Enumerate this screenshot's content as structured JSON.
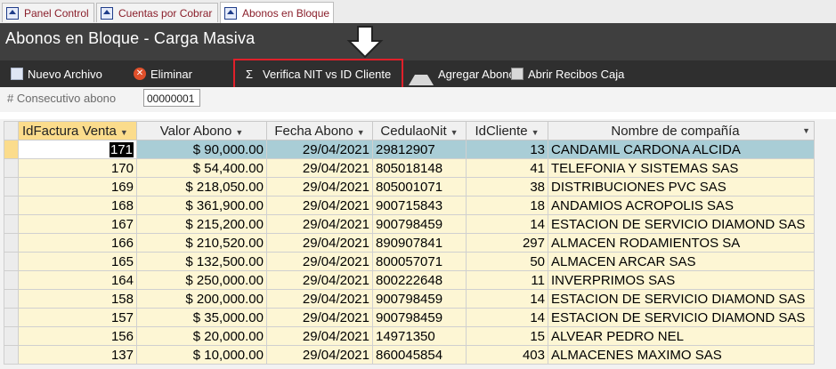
{
  "tabs": [
    {
      "label": "Panel Control"
    },
    {
      "label": "Cuentas por Cobrar"
    },
    {
      "label": "Abonos en Bloque"
    }
  ],
  "header": {
    "title": "Abonos en Bloque - Carga Masiva"
  },
  "toolbar": {
    "new_file": "Nuevo Archivo",
    "delete": "Eliminar",
    "verify": "Verifica NIT vs ID Cliente",
    "add_payments": "Agregar Abonos",
    "open_receipts": "Abrir Recibos Caja"
  },
  "consecutivo": {
    "label": "# Consecutivo abono",
    "value": "00000001"
  },
  "columns": [
    "IdFactura Venta",
    "Valor Abono",
    "Fecha Abono",
    "CedulaoNit",
    "IdCliente",
    "Nombre de compañía"
  ],
  "rows": [
    [
      "171",
      "$ 90,000.00",
      "29/04/2021",
      "29812907",
      "13",
      "CANDAMIL CARDONA ALCIDA"
    ],
    [
      "170",
      "$ 54,400.00",
      "29/04/2021",
      "805018148",
      "41",
      "TELEFONIA Y SISTEMAS SAS"
    ],
    [
      "169",
      "$ 218,050.00",
      "29/04/2021",
      "805001071",
      "38",
      "DISTRIBUCIONES PVC SAS"
    ],
    [
      "168",
      "$ 361,900.00",
      "29/04/2021",
      "900715843",
      "18",
      "ANDAMIOS ACROPOLIS SAS"
    ],
    [
      "167",
      "$ 215,200.00",
      "29/04/2021",
      "900798459",
      "14",
      "ESTACION DE SERVICIO DIAMOND SAS"
    ],
    [
      "166",
      "$ 210,520.00",
      "29/04/2021",
      "890907841",
      "297",
      "ALMACEN RODAMIENTOS SA"
    ],
    [
      "165",
      "$ 132,500.00",
      "29/04/2021",
      "800057071",
      "50",
      "ALMACEN ARCAR SAS"
    ],
    [
      "164",
      "$ 250,000.00",
      "29/04/2021",
      "800222648",
      "11",
      "INVERPRIMOS SAS"
    ],
    [
      "158",
      "$ 200,000.00",
      "29/04/2021",
      "900798459",
      "14",
      "ESTACION DE SERVICIO DIAMOND SAS"
    ],
    [
      "157",
      "$ 35,000.00",
      "29/04/2021",
      "900798459",
      "14",
      "ESTACION DE SERVICIO DIAMOND SAS"
    ],
    [
      "156",
      "$ 20,000.00",
      "29/04/2021",
      "14971350",
      "15",
      "ALVEAR PEDRO NEL"
    ],
    [
      "137",
      "$ 10,000.00",
      "29/04/2021",
      "860045854",
      "403",
      "ALMACENES MAXIMO SAS"
    ]
  ],
  "colors": {
    "highlight": "#e0202a",
    "header_bg": "#3f3f3f",
    "toolbar_bg": "#2f2f2f",
    "current_row": "#a9cdd6",
    "row_bg": "#fdf6d4"
  }
}
